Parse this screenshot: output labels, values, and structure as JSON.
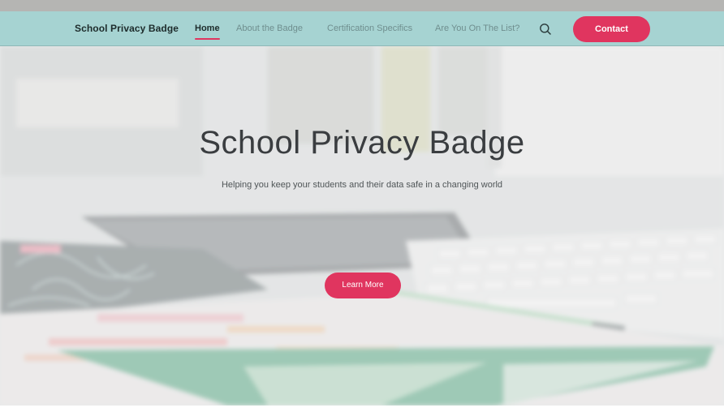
{
  "nav": {
    "brand": "School Privacy Badge",
    "items": [
      {
        "label": "Home",
        "active": true
      },
      {
        "label": "About the Badge",
        "active": false
      },
      {
        "label": "Certification Specifics",
        "active": false
      },
      {
        "label": "Are You On The List?",
        "active": false
      }
    ],
    "search_icon": "search-icon",
    "contact_label": "Contact"
  },
  "hero": {
    "title": "School Privacy Badge",
    "subtitle": "Helping you keep your students and their data safe in a changing world",
    "cta_label": "Learn More"
  },
  "colors": {
    "accent": "#e0355f",
    "navbar": "#a6d3d2",
    "brand_text": "#1d2b2b",
    "nav_inactive": "#6f8e8e"
  }
}
